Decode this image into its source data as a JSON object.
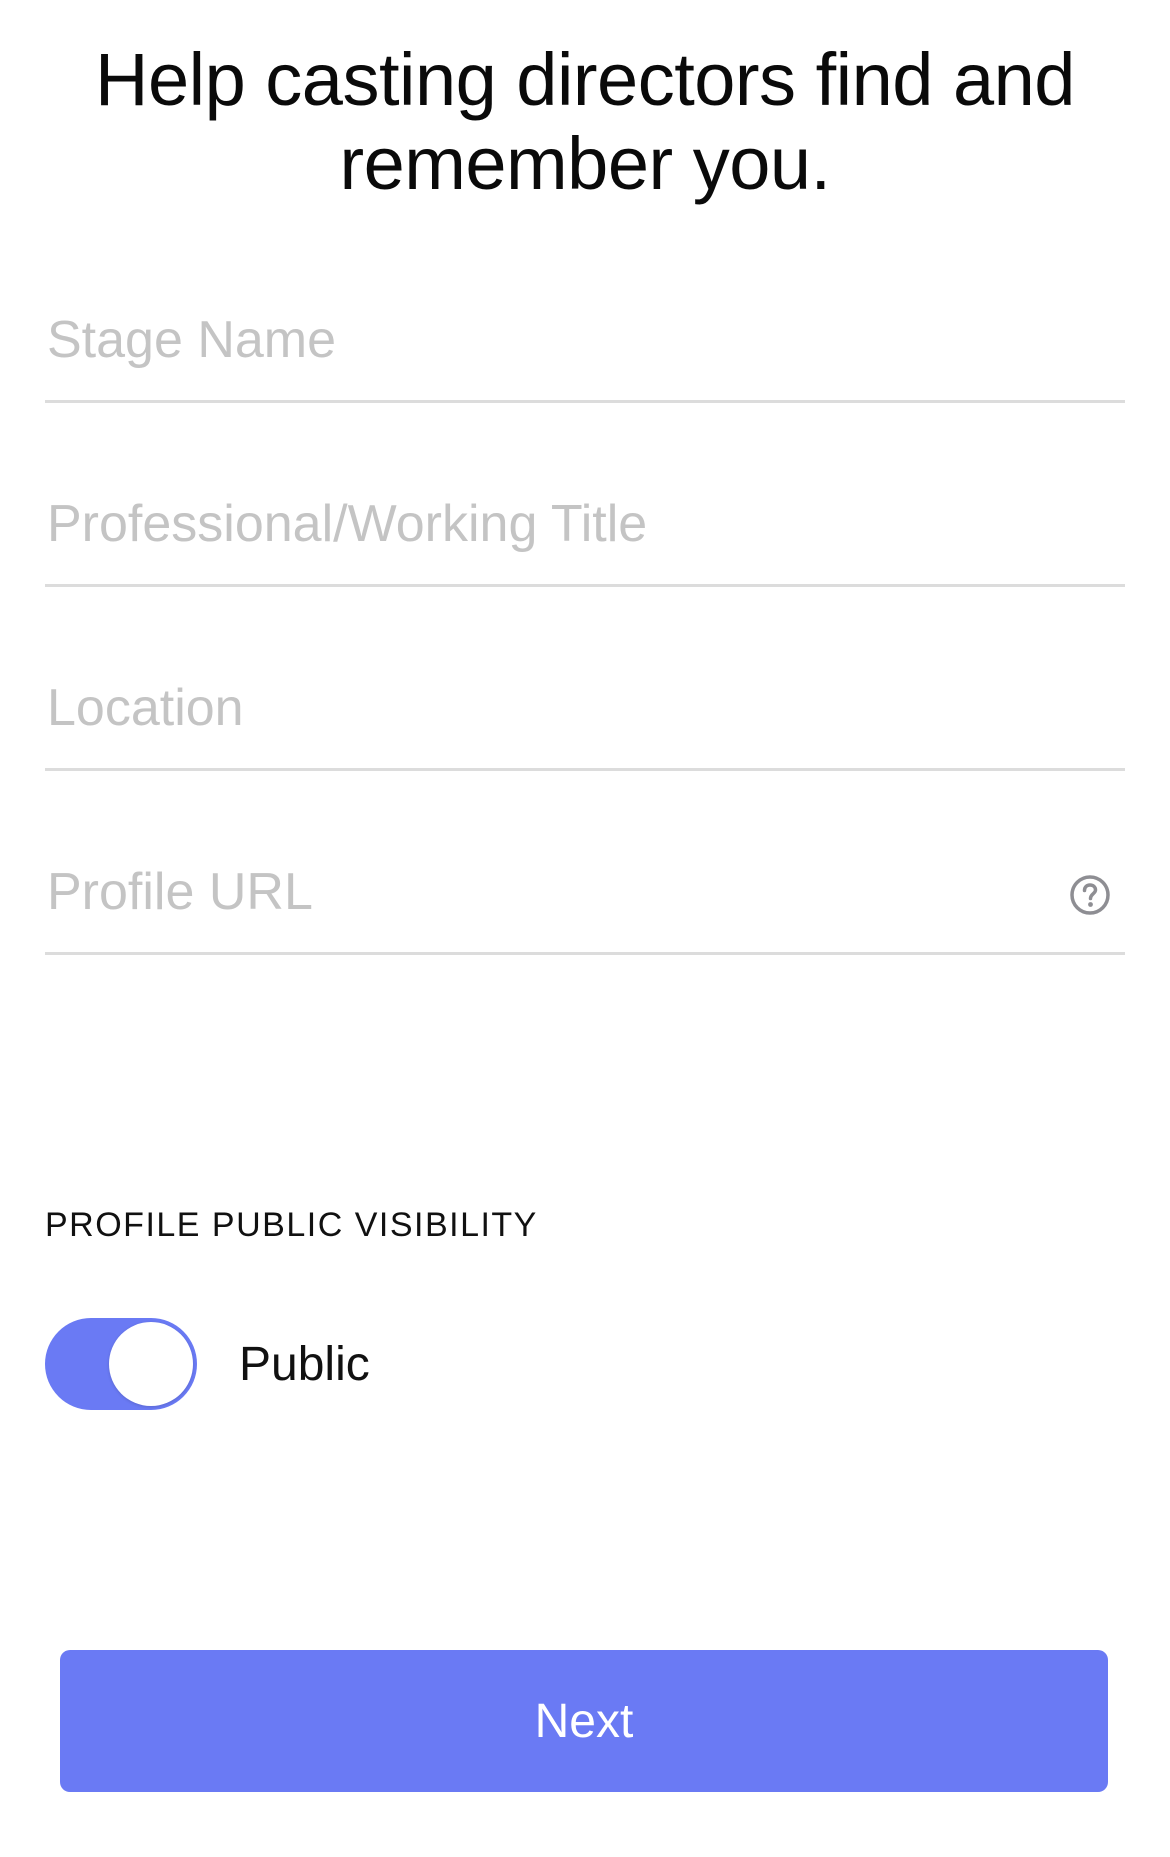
{
  "header": {
    "title": "Help casting directors find and remember you."
  },
  "form": {
    "stage_name": {
      "placeholder": "Stage Name",
      "value": ""
    },
    "professional_title": {
      "placeholder": "Professional/Working Title",
      "value": ""
    },
    "location": {
      "placeholder": "Location",
      "value": ""
    },
    "profile_url": {
      "placeholder": "Profile URL",
      "value": "",
      "help_icon": "question-circle-icon"
    }
  },
  "visibility": {
    "section_label": "PROFILE PUBLIC VISIBILITY",
    "toggle_on": true,
    "toggle_label": "Public"
  },
  "actions": {
    "next_label": "Next"
  },
  "colors": {
    "accent": "#6a7af4",
    "placeholder": "#c4c4c4",
    "divider": "#dcdcdc",
    "icon": "#8e8e93"
  }
}
